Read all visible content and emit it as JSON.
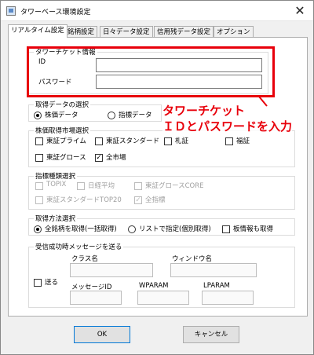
{
  "window": {
    "title": "タワーベース環境設定",
    "close_label": "✕"
  },
  "tabs": [
    {
      "label": "リアルタイム設定",
      "active": true
    },
    {
      "label": "銘柄設定"
    },
    {
      "label": "日々データ設定"
    },
    {
      "label": "信用残データ設定"
    },
    {
      "label": "オプション"
    }
  ],
  "tower_ticket": {
    "title": "タワーチケット情報",
    "id_label": "ID",
    "id_value": "",
    "password_label": "パスワード",
    "password_value": ""
  },
  "annotation": {
    "line1": "タワーチケット",
    "line2": "ＩＤとパスワードを入力"
  },
  "data_selection": {
    "title": "取得データの選択",
    "options": [
      "株価データ",
      "指標データ"
    ],
    "selected": 0
  },
  "market_selection": {
    "title": "株価取得市場選択",
    "items": [
      {
        "label": "東証プライム",
        "checked": false
      },
      {
        "label": "東証スタンダード",
        "checked": false
      },
      {
        "label": "札証",
        "checked": false
      },
      {
        "label": "福証",
        "checked": false
      },
      {
        "label": "東証グロース",
        "checked": false
      },
      {
        "label": "全市場",
        "checked": true
      }
    ]
  },
  "index_selection": {
    "title": "指標種類選択",
    "items": [
      {
        "label": "TOPIX",
        "checked": false
      },
      {
        "label": "日経平均",
        "checked": false
      },
      {
        "label": "東証グロースCORE",
        "checked": false
      },
      {
        "label": "東証スタンダードTOP20",
        "checked": false
      },
      {
        "label": "全指標",
        "checked": true
      }
    ]
  },
  "method_selection": {
    "title": "取得方法選択",
    "options": [
      "全銘柄を取得(一括取得)",
      "リストで指定(個別取得)"
    ],
    "selected": 0,
    "board_info_label": "板情報も取得"
  },
  "message_settings": {
    "title": "受信成功時メッセージを送る",
    "send_label": "送る",
    "class_name_label": "クラス名",
    "window_name_label": "ウィンドウ名",
    "message_id_label": "メッセージID",
    "wparam_label": "WPARAM",
    "lparam_label": "LPARAM"
  },
  "buttons": {
    "ok": "OK",
    "cancel": "キャンセル"
  },
  "colors": {
    "accent": "#e8000b",
    "focus": "#0078d7"
  }
}
